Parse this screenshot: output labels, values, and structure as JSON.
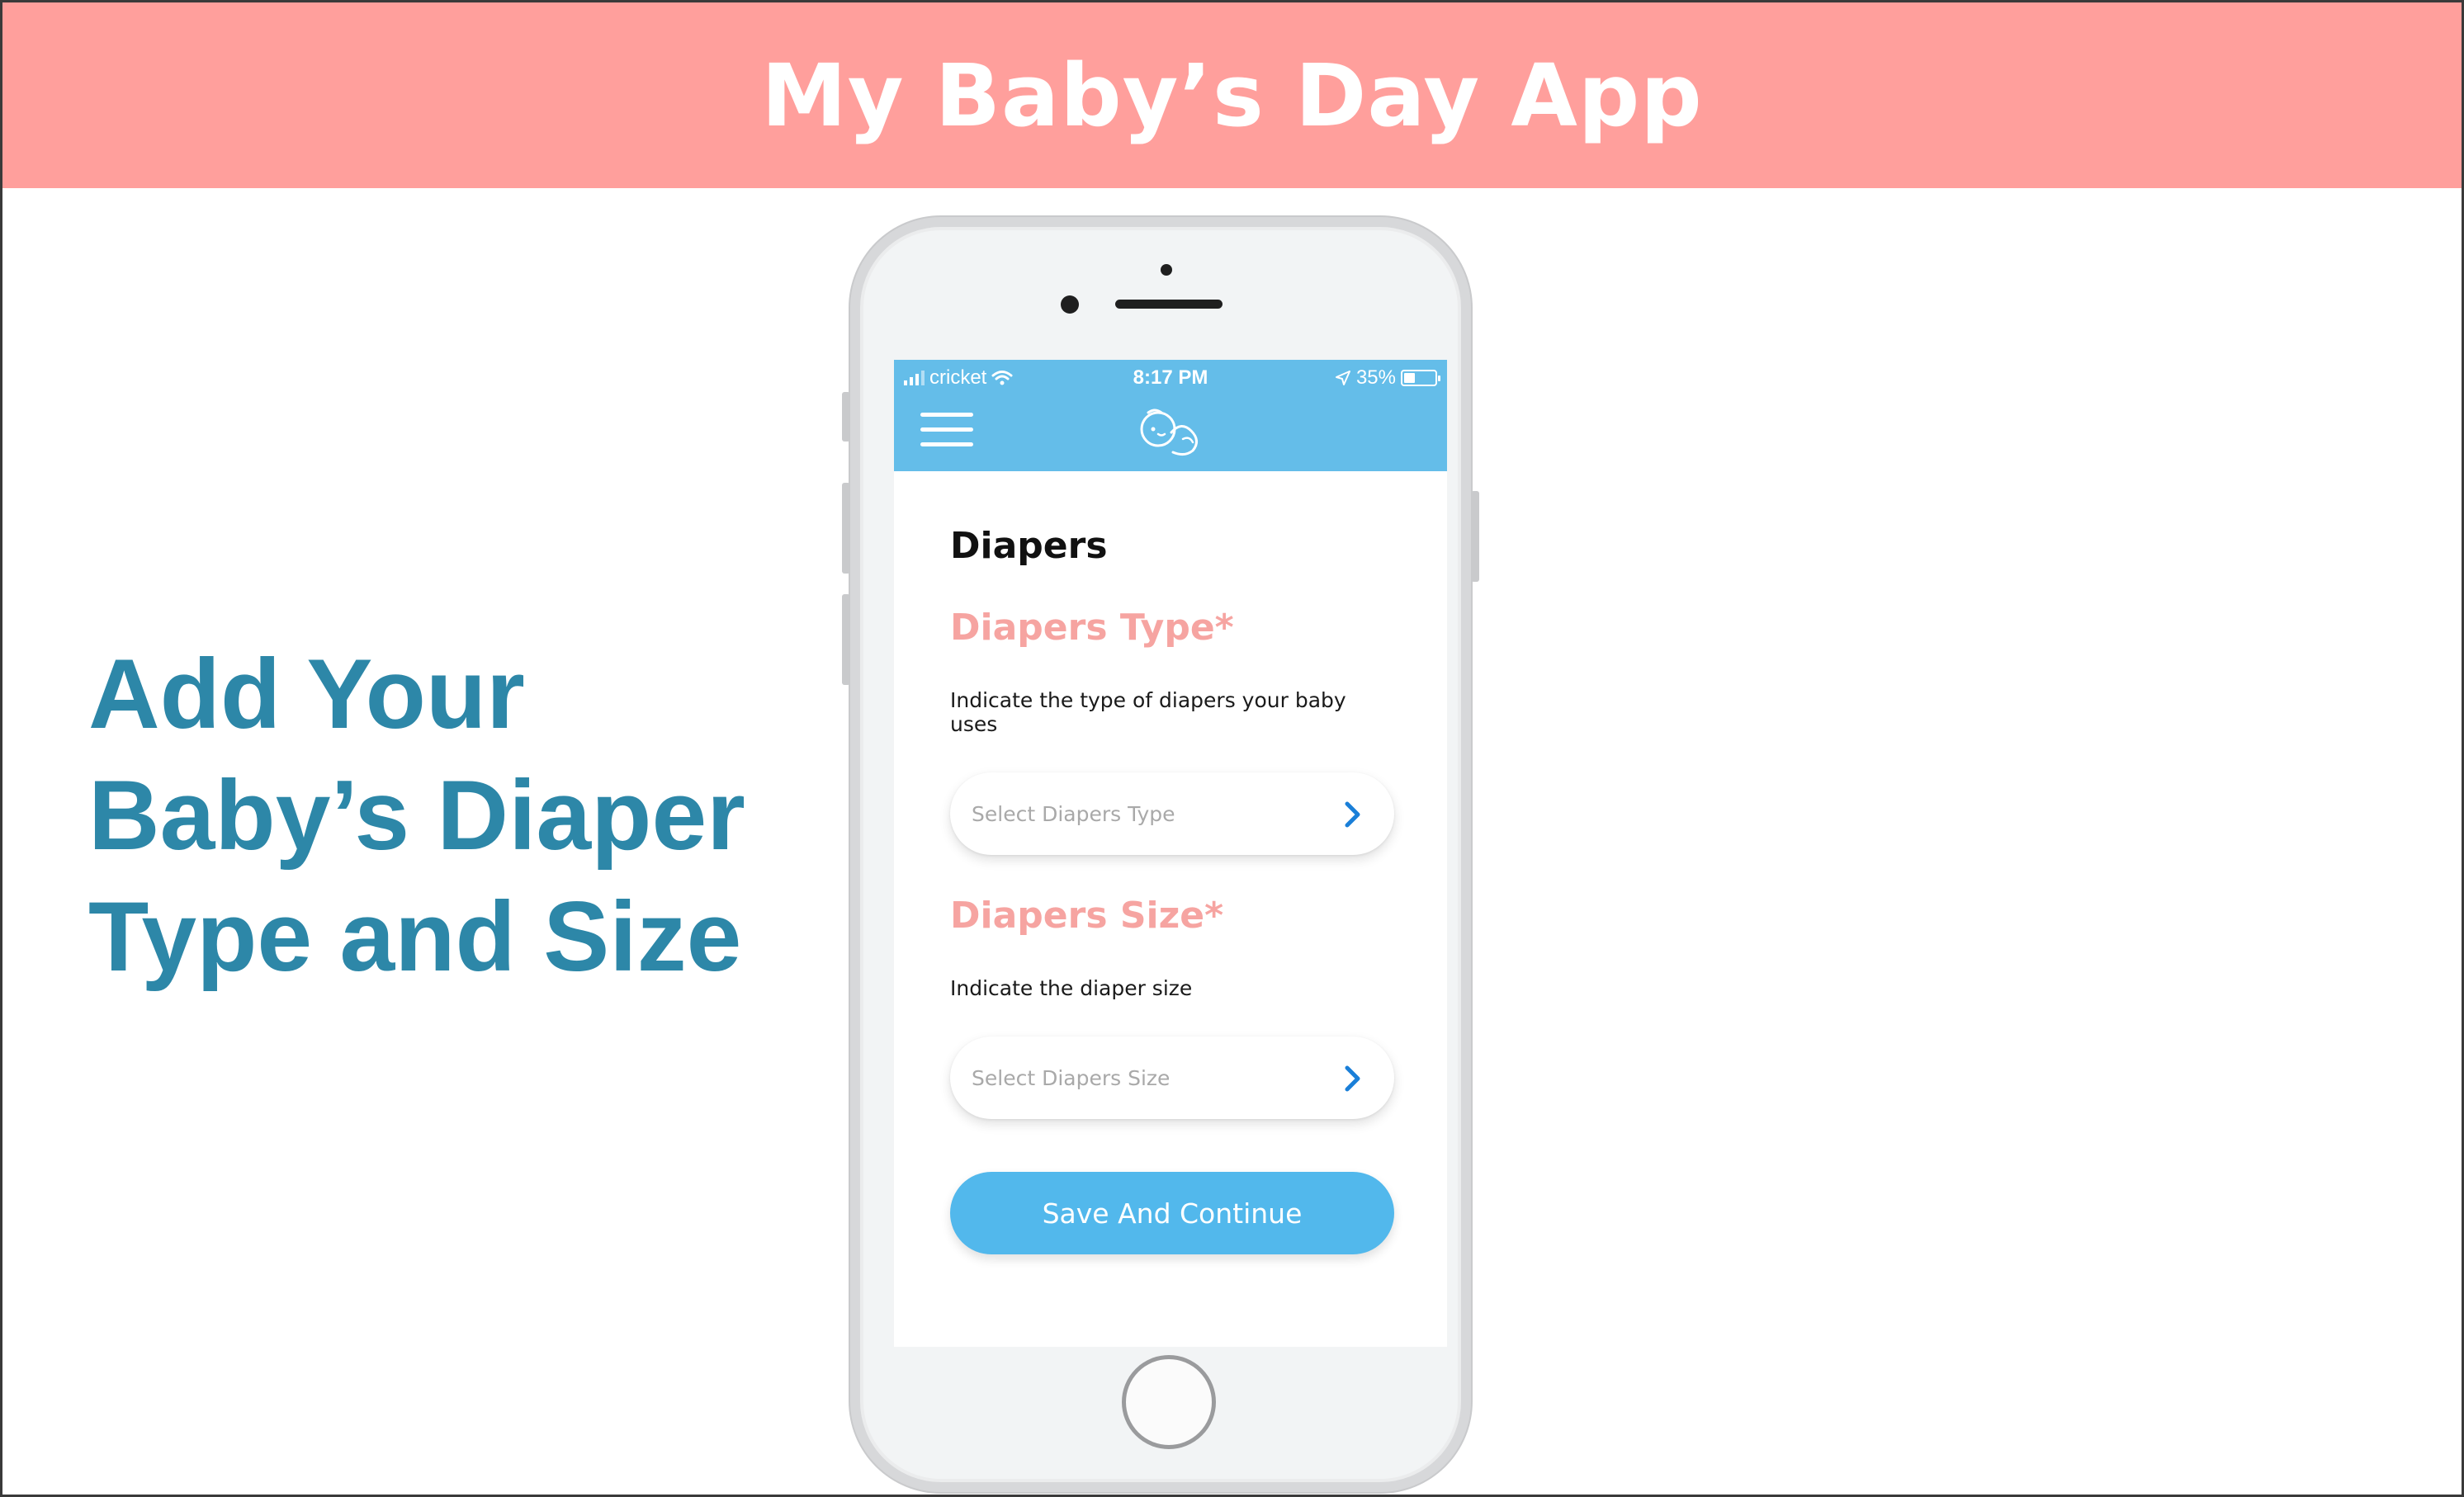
{
  "banner": {
    "title": "My Baby’s Day App"
  },
  "headline": {
    "line1": "Add Your",
    "line2": "Baby’s Diaper",
    "line3": "Type and Size"
  },
  "status_bar": {
    "carrier": "cricket",
    "time": "8:17 PM",
    "battery_percent": "35%",
    "battery_level": 0.35,
    "icons": [
      "signal-icon",
      "wifi-icon",
      "location-arrow-icon",
      "battery-icon"
    ]
  },
  "app_header": {
    "menu_icon": "hamburger-menu-icon",
    "logo": "baby-logo-icon"
  },
  "screen": {
    "title": "Diapers",
    "type_section": {
      "label": "Diapers Type*",
      "hint": "Indicate the type of diapers your baby uses",
      "placeholder": "Select Diapers Type"
    },
    "size_section": {
      "label": "Diapers Size*",
      "hint": "Indicate the diaper size",
      "placeholder": "Select Diapers Size"
    },
    "save_label": "Save And Continue"
  },
  "colors": {
    "banner": "#ff9f9c",
    "headline": "#2d87a8",
    "app_bar": "#64bde9",
    "section_label": "#f6a4a1",
    "button": "#52b8ec",
    "chevron": "#1a7fd8"
  }
}
